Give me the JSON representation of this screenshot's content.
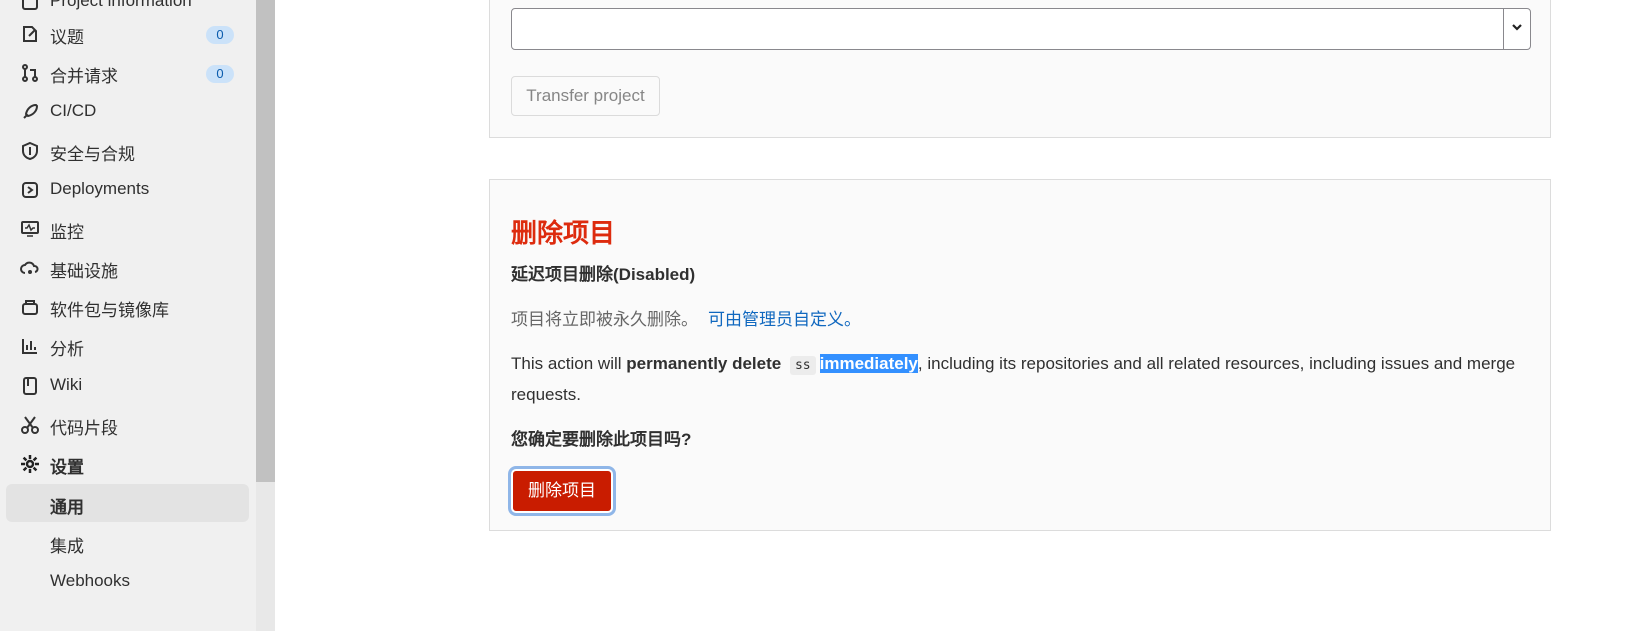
{
  "sidebar": {
    "items": [
      {
        "label": "Project information",
        "icon": "project-info-icon"
      },
      {
        "label": "议题",
        "badge": "0",
        "icon": "issues-icon"
      },
      {
        "label": "合并请求",
        "badge": "0",
        "icon": "merge-request-icon"
      },
      {
        "label": "CI/CD",
        "icon": "rocket-icon"
      },
      {
        "label": "安全与合规",
        "icon": "shield-icon"
      },
      {
        "label": "Deployments",
        "icon": "deployments-icon"
      },
      {
        "label": "监控",
        "icon": "monitor-icon"
      },
      {
        "label": "基础设施",
        "icon": "cloud-gear-icon"
      },
      {
        "label": "软件包与镜像库",
        "icon": "package-icon"
      },
      {
        "label": "分析",
        "icon": "chart-icon"
      },
      {
        "label": "Wiki",
        "icon": "book-icon"
      },
      {
        "label": "代码片段",
        "icon": "scissors-icon"
      },
      {
        "label": "设置",
        "icon": "gear-icon"
      }
    ],
    "settings_sub": [
      {
        "label": "通用"
      },
      {
        "label": "集成"
      },
      {
        "label": "Webhooks"
      }
    ]
  },
  "transfer": {
    "select_value": "",
    "button_label": "Transfer project"
  },
  "delete": {
    "title": "删除项目",
    "subtitle": "延迟项目删除(Disabled)",
    "note": "项目将立即被永久删除。",
    "note_link": "可由管理员自定义。",
    "desc_prefix": "This action will",
    "desc_bold": "permanently delete",
    "project_name": "ss",
    "desc_highlight": "immediately",
    "desc_suffix": ", including its repositories and all related resources, including issues and merge requests.",
    "confirm": "您确定要删除此项目吗?",
    "button_label": "删除项目"
  },
  "colors": {
    "danger": "#dd2b0e",
    "danger_button": "#c91c00",
    "link": "#1068bf",
    "selection": "#3390ff"
  }
}
